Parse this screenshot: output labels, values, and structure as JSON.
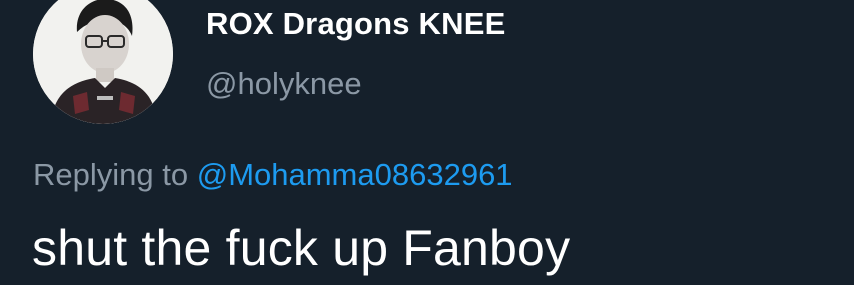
{
  "tweet": {
    "author": {
      "display_name": "ROX Dragons KNEE",
      "handle": "@holyknee",
      "avatar_icon": "profile-photo"
    },
    "reply": {
      "prefix": "Replying to",
      "mention": "@Mohamma08632961"
    },
    "text": "shut the fuck up Fanboy"
  },
  "colors": {
    "background": "#15202b",
    "primary_text": "#ffffff",
    "secondary_text": "#8b98a5",
    "link": "#1d9bf0"
  }
}
